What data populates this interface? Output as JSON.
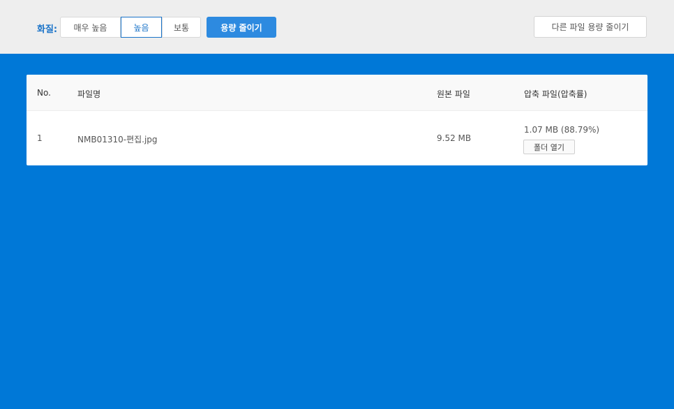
{
  "toolbar": {
    "quality_label": "화질:",
    "quality_options": [
      "매우 높음",
      "높음",
      "보통"
    ],
    "selected_quality": "높음",
    "reduce_button": "용량 줄이기",
    "other_file_button": "다른 파일 용량 줄이기"
  },
  "table": {
    "headers": {
      "no": "No.",
      "name": "파일명",
      "original": "원본 파일",
      "compressed": "압축 파일(압축률)"
    },
    "rows": [
      {
        "no": "1",
        "name": "NMB01310-편집.jpg",
        "original": "9.52 MB",
        "compressed": "1.07 MB (88.79%)",
        "folder_button": "폴더 열기"
      }
    ]
  },
  "colors": {
    "background": "#0078d7",
    "topbar": "#eeeeee",
    "accent": "#1a73c8",
    "primary_button": "#2d8ae0"
  }
}
